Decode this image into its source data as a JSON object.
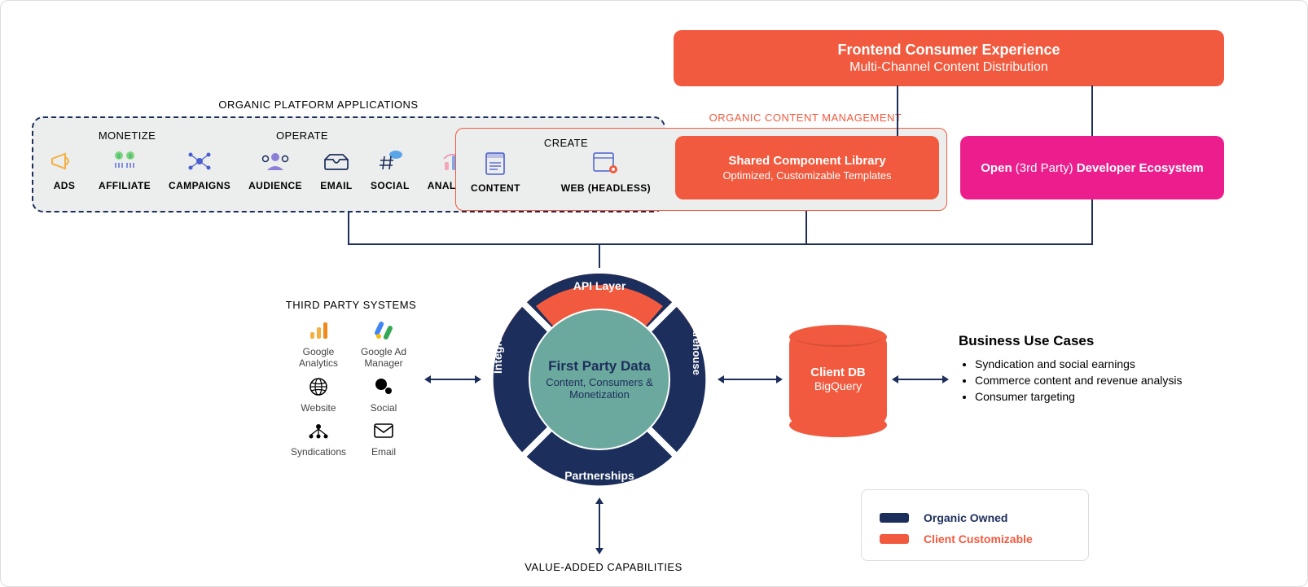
{
  "frontend": {
    "title": "Frontend Consumer Experience",
    "subtitle": "Multi-Channel Content Distribution"
  },
  "sections": {
    "organic_platform": "ORGANIC PLATFORM APPLICATIONS",
    "organic_content_mgmt": "ORGANIC CONTENT MANAGEMENT",
    "third_party_systems": "THIRD PARTY SYSTEMS",
    "value_added": "VALUE-ADDED CAPABILITIES"
  },
  "groups": {
    "monetize": "MONETIZE",
    "operate": "OPERATE",
    "create": "CREATE"
  },
  "apps": {
    "ads": "ADS",
    "affiliate": "AFFILIATE",
    "campaigns": "CAMPAIGNS",
    "audience": "AUDIENCE",
    "email": "EMAIL",
    "social": "SOCIAL",
    "analytics": "ANALYTICS",
    "content": "CONTENT",
    "web_headless": "WEB (HEADLESS)"
  },
  "shared_component": {
    "title": "Shared Component Library",
    "subtitle": "Optimized, Customizable Templates"
  },
  "dev_ecosystem": {
    "prefix": "Open",
    "paren": "(3rd Party)",
    "suffix": "Developer Ecosystem"
  },
  "hub": {
    "api_layer": "API Layer",
    "integrations": "Integrations",
    "data_warehouse": "Data Warehouse",
    "partnerships": "Partnerships",
    "center_title": "First Party Data",
    "center_sub": "Content, Consumers & Monetization"
  },
  "third_party": {
    "google_analytics": "Google Analytics",
    "google_ad_manager": "Google Ad Manager",
    "website": "Website",
    "social": "Social",
    "syndications": "Syndications",
    "email": "Email"
  },
  "client_db": {
    "title": "Client DB",
    "subtitle": "BigQuery"
  },
  "use_cases": {
    "heading": "Business Use Cases",
    "items": [
      "Syndication and social earnings",
      "Commerce content and revenue analysis",
      "Consumer targeting"
    ]
  },
  "legend": {
    "organic_owned": "Organic Owned",
    "client_customizable": "Client Customizable",
    "colors": {
      "navy": "#1c2e5b",
      "orange": "#f15a3e",
      "pink": "#ec1e8e"
    }
  }
}
